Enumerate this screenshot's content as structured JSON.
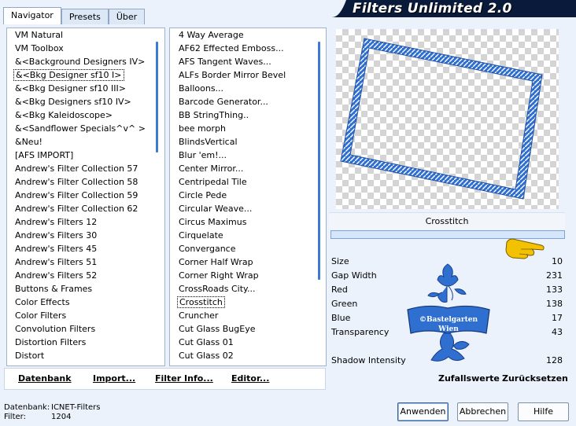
{
  "tabs": [
    "Navigator",
    "Presets",
    "Über"
  ],
  "title": "Filters Unlimited 2.0",
  "categories": [
    "VM Natural",
    "VM Toolbox",
    "&<Background Designers IV>",
    "&<Bkg Designer sf10 I>",
    "&<Bkg Designer sf10 III>",
    "&<Bkg Designers sf10 IV>",
    "&<Bkg Kaleidoscope>",
    "&<Sandflower Specials^v^ >",
    "&Neu!",
    "[AFS IMPORT]",
    "Andrew's Filter Collection 57",
    "Andrew's Filter Collection 58",
    "Andrew's Filter Collection 59",
    "Andrew's Filter Collection 62",
    "Andrew's Filters 12",
    "Andrew's Filters 30",
    "Andrew's Filters 45",
    "Andrew's Filters 51",
    "Andrew's Filters 52",
    "Buttons & Frames",
    "Color Effects",
    "Color Filters",
    "Convolution Filters",
    "Distortion Filters",
    "Distort"
  ],
  "filters": [
    "4 Way Average",
    "AF62 Effected Emboss...",
    "AFS Tangent Waves...",
    "ALFs Border Mirror Bevel",
    "Balloons...",
    "Barcode Generator...",
    "BB StringThing..",
    "bee morph",
    "BlindsVertical",
    "Blur 'em!...",
    "Center Mirror...",
    "Centripedal Tile",
    "Circle Pede",
    "Circular Weave...",
    "Circus Maximus",
    "Cirquelate",
    "Convergance",
    "Corner Half Wrap",
    "Corner Right Wrap",
    "CrossRoads City...",
    "Crosstitch",
    "Cruncher",
    "Cut Glass  BugEye",
    "Cut Glass 01",
    "Cut Glass 02"
  ],
  "selected_filter": "Crosstitch",
  "params": [
    {
      "label": "Size",
      "value": "10"
    },
    {
      "label": "Gap Width",
      "value": "231"
    },
    {
      "label": "Red",
      "value": "133"
    },
    {
      "label": "Green",
      "value": "138"
    },
    {
      "label": "Blue",
      "value": "17"
    },
    {
      "label": "Transparency",
      "value": "43"
    },
    {
      "label": "Shadow Intensity",
      "value": "128"
    }
  ],
  "watermark": {
    "line1": "©Bastelgarten",
    "line2": "Wien"
  },
  "links": {
    "datenbank": "Datenbank",
    "import": "Import...",
    "filter_info": "Filter Info...",
    "editor": "Editor...",
    "zufallswerte": "Zufallswerte",
    "zuruecksetzen": "Zurücksetzen"
  },
  "status": {
    "db_label": "Datenbank:",
    "db_value": "ICNET-Filters",
    "filter_label": "Filter:",
    "filter_value": "1204"
  },
  "buttons": {
    "apply": "Anwenden",
    "cancel": "Abbrechen",
    "help": "Hilfe"
  },
  "colors": {
    "accent": "#3d7ad6",
    "title_band": "#0a1a3a",
    "frame_blue": "#2f6fd0",
    "hand": "#f2c200"
  }
}
